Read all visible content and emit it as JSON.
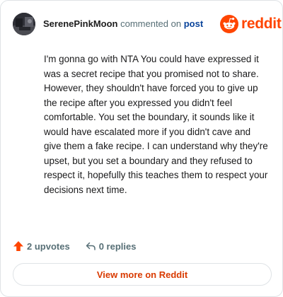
{
  "header": {
    "username": "SerenePinkMoon",
    "commented_text": "commented on",
    "post_link": "post"
  },
  "brand": {
    "name": "reddit",
    "color": "#ff4500"
  },
  "comment": {
    "body": "I'm gonna go with NTA You could have expressed it was a secret recipe that you promised not to share. However, they shouldn't have forced you to give up the recipe after you expressed you didn't feel comfortable. You set the boundary, it sounds like it would have escalated more if you didn't cave and give them a fake recipe. I can understand why they're upset, but you set a boundary and they refused to respect it, hopefully this teaches them to respect your decisions next time."
  },
  "actions": {
    "upvotes_label": "2 upvotes",
    "replies_label": "0 replies",
    "upvote_icon": "upvote-arrow-icon",
    "reply_icon": "reply-arrow-icon"
  },
  "footer": {
    "view_more_label": "View more on Reddit"
  },
  "colors": {
    "upvote": "#ff4500",
    "link": "#0a449b",
    "cta": "#d93a00",
    "muted": "#576f76"
  }
}
